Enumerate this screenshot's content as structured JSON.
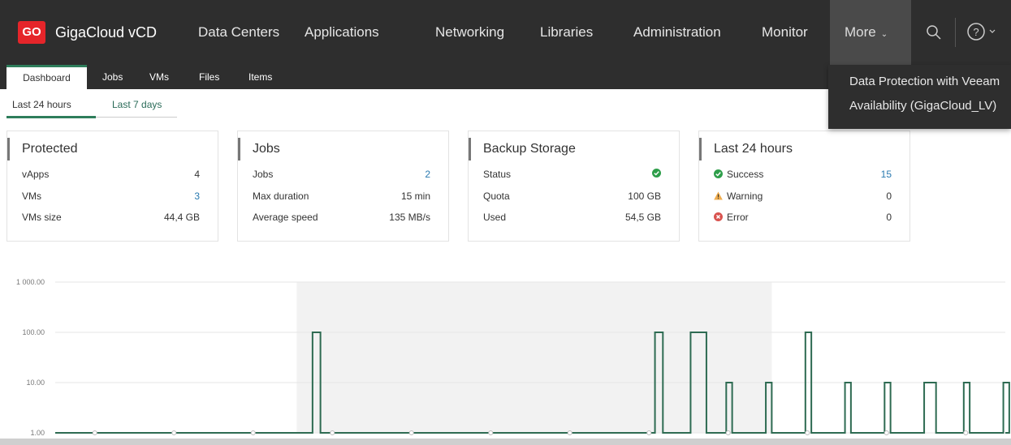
{
  "app": {
    "logo_text": "GO",
    "title": "GigaCloud vCD"
  },
  "nav": {
    "items": [
      "Data Centers",
      "Applications",
      "Networking",
      "Libraries",
      "Administration",
      "Monitor"
    ],
    "more_label": "More",
    "icons": [
      "search-icon",
      "help-icon"
    ]
  },
  "subtabs": [
    "Dashboard",
    "Jobs",
    "VMs",
    "Files",
    "Items"
  ],
  "range_tabs": [
    "Last 24 hours",
    "Last 7 days"
  ],
  "dropdown": [
    "Data Protection with Veeam",
    "Availability (GigaCloud_LV)"
  ],
  "cards": {
    "protected": {
      "title": "Protected",
      "rows": [
        {
          "label": "vApps",
          "value": "4"
        },
        {
          "label": "VMs",
          "value": "3"
        },
        {
          "label": "VMs size",
          "value": "44,4 GB"
        }
      ]
    },
    "jobs": {
      "title": "Jobs",
      "rows": [
        {
          "label": "Jobs",
          "value": "2"
        },
        {
          "label": "Max duration",
          "value": "15 min"
        },
        {
          "label": "Average speed",
          "value": "135 MB/s"
        }
      ]
    },
    "storage": {
      "title": "Backup Storage",
      "rows": [
        {
          "label": "Status",
          "value": ""
        },
        {
          "label": "Quota",
          "value": "100 GB"
        },
        {
          "label": "Used",
          "value": "54,5 GB"
        }
      ]
    },
    "last24": {
      "title": "Last 24 hours",
      "rows": [
        {
          "label": "Success",
          "value": "15"
        },
        {
          "label": "Warning",
          "value": "0"
        },
        {
          "label": "Error",
          "value": "0"
        }
      ]
    }
  },
  "colors": {
    "accent": "#2e7d5b",
    "link": "#2a7ab0",
    "topbar": "#2e2e2e",
    "error": "#d9534f",
    "warning": "#f0ad4e",
    "success": "#2e9e4a"
  },
  "chart_data": {
    "type": "line",
    "scale": "log",
    "y_ticks": [
      "1 000.00",
      "100.00",
      "10.00",
      "1.00"
    ],
    "y_tick_values": [
      1000,
      100,
      10,
      1
    ],
    "ylim": [
      1,
      1000
    ],
    "x": [
      0,
      1,
      2,
      3,
      4,
      5,
      6,
      7,
      8,
      9,
      10,
      11,
      12,
      13,
      14,
      15,
      16,
      17,
      18,
      19,
      20,
      21,
      22,
      23,
      24
    ],
    "values": [
      1,
      1,
      1,
      1,
      1,
      1,
      1,
      1,
      1,
      1,
      1,
      1,
      1,
      1,
      1,
      1,
      1,
      1,
      1,
      1,
      1,
      1,
      1,
      1,
      1
    ],
    "spikes": [
      {
        "start": 6.5,
        "end": 6.7,
        "value": 100
      },
      {
        "start": 15.15,
        "end": 15.35,
        "value": 100
      },
      {
        "start": 16.05,
        "end": 16.45,
        "value": 100
      },
      {
        "start": 16.95,
        "end": 17.1,
        "value": 10
      },
      {
        "start": 17.95,
        "end": 18.1,
        "value": 10
      },
      {
        "start": 18.95,
        "end": 19.1,
        "value": 100
      },
      {
        "start": 19.95,
        "end": 20.1,
        "value": 10
      },
      {
        "start": 20.95,
        "end": 21.1,
        "value": 10
      },
      {
        "start": 21.95,
        "end": 22.25,
        "value": 10
      },
      {
        "start": 22.95,
        "end": 23.1,
        "value": 10
      },
      {
        "start": 23.95,
        "end": 24.1,
        "value": 10
      }
    ],
    "shaded_range": [
      6.1,
      18.1
    ],
    "grid": true
  }
}
